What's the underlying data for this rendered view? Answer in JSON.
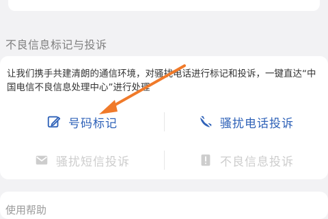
{
  "section": {
    "title": "不良信息标记与投诉",
    "description": "让我们携手共建清朗的通信环境，对骚扰电话进行标记和投诉，一键直达“中国电信不良信息处理中心”进行处理"
  },
  "actions": [
    {
      "label": "号码标记",
      "icon": "edit-icon",
      "state": "enabled"
    },
    {
      "label": "骚扰电话投诉",
      "icon": "phone-block-icon",
      "state": "enabled"
    },
    {
      "label": "骚扰短信投诉",
      "icon": "message-icon",
      "state": "disabled"
    },
    {
      "label": "不良信息投诉",
      "icon": "report-icon",
      "state": "disabled"
    }
  ],
  "next_section": {
    "title": "使用帮助"
  },
  "colors": {
    "accent": "#2f62b8",
    "disabled": "#cdcdcd",
    "arrow": "#f07a2a"
  }
}
